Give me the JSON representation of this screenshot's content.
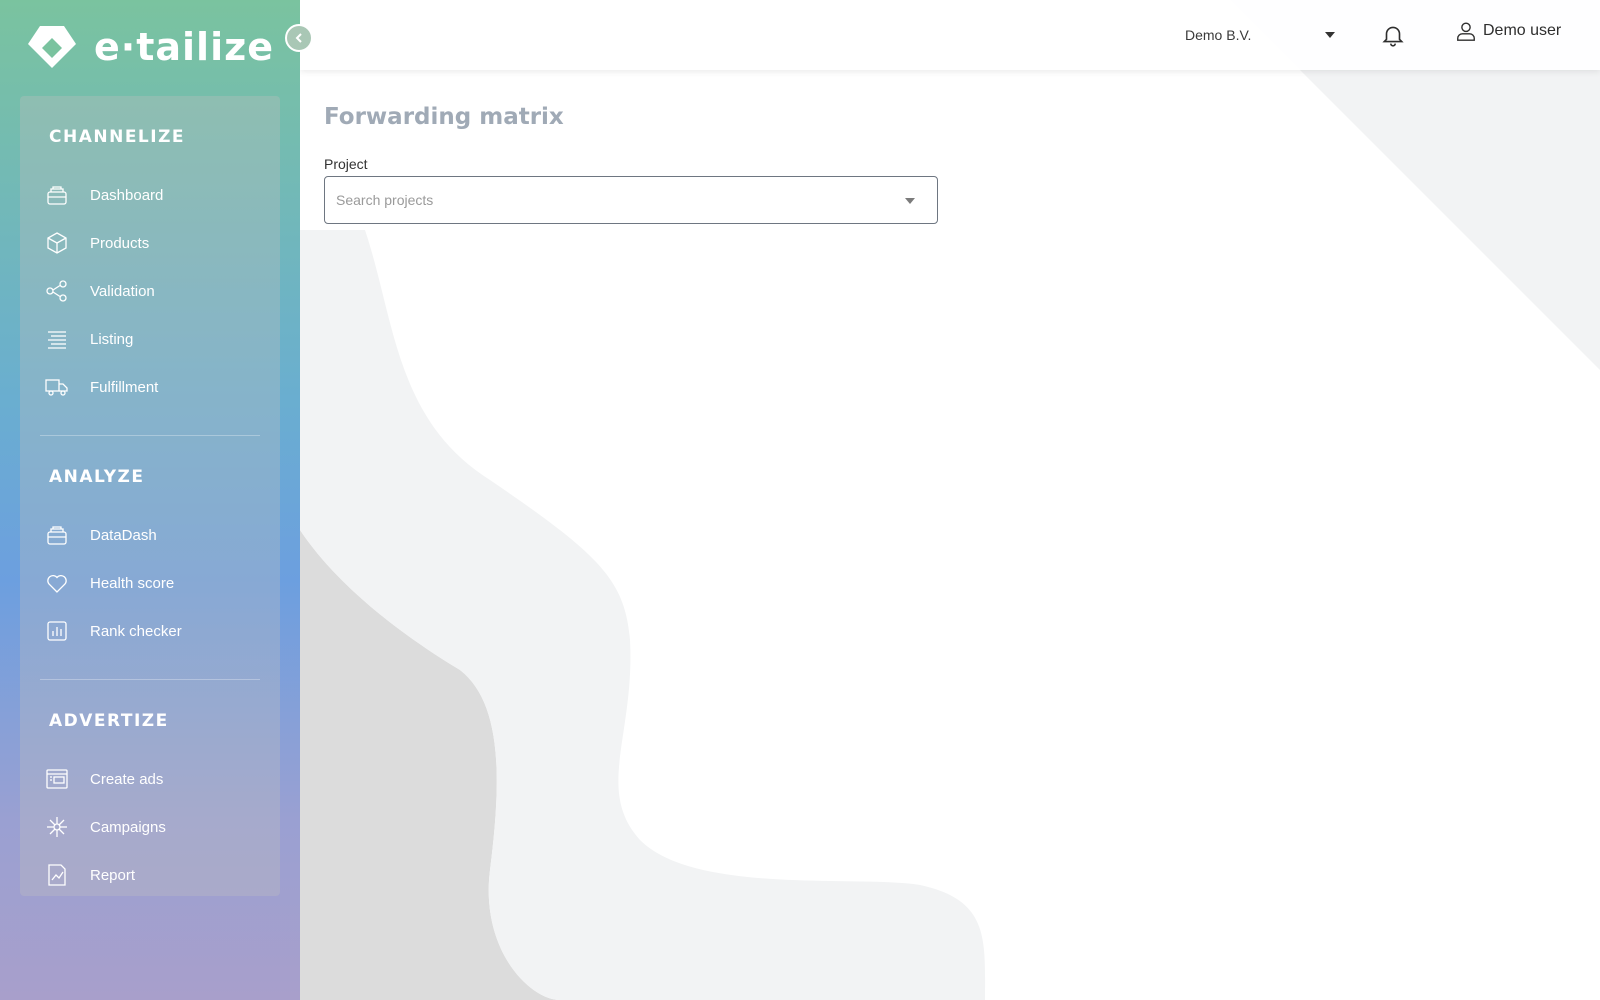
{
  "brand": {
    "logo_text": "e·tailize"
  },
  "sidebar": {
    "sections": [
      {
        "title": "CHANNELIZE",
        "items": [
          {
            "label": "Dashboard",
            "icon": "dashboard-icon"
          },
          {
            "label": "Products",
            "icon": "box-icon"
          },
          {
            "label": "Validation",
            "icon": "share-nodes-icon"
          },
          {
            "label": "Listing",
            "icon": "list-icon"
          },
          {
            "label": "Fulfillment",
            "icon": "truck-icon"
          }
        ]
      },
      {
        "title": "ANALYZE",
        "items": [
          {
            "label": "DataDash",
            "icon": "datadash-icon"
          },
          {
            "label": "Health score",
            "icon": "heart-icon"
          },
          {
            "label": "Rank checker",
            "icon": "bar-chart-icon"
          }
        ]
      },
      {
        "title": "ADVERTIZE",
        "items": [
          {
            "label": "Create ads",
            "icon": "ads-icon"
          },
          {
            "label": "Campaigns",
            "icon": "campaigns-icon"
          },
          {
            "label": "Report",
            "icon": "report-icon"
          }
        ]
      }
    ]
  },
  "header": {
    "organization": "Demo B.V.",
    "user_name": "Demo user"
  },
  "main": {
    "title": "Forwarding matrix",
    "project_label": "Project",
    "project_placeholder": "Search projects",
    "project_value": ""
  },
  "colors": {
    "sidebar_gradient_top": "#7ac39f",
    "sidebar_gradient_mid": "#6c9fdf",
    "sidebar_gradient_bottom": "#a89fcb",
    "title": "#a0aab6",
    "background_shape": "#f2f3f4"
  }
}
